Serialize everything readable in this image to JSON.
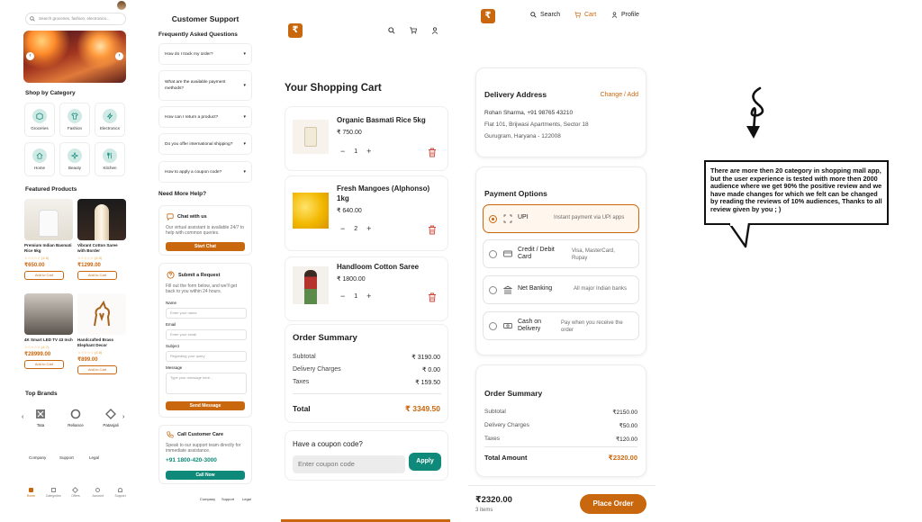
{
  "home": {
    "search_placeholder": "Search groceries, fashion, electronics...",
    "shop_by_category": "Shop by Category",
    "categories": [
      {
        "label": "Groceries",
        "icon": "grocery-icon"
      },
      {
        "label": "Fashion",
        "icon": "shirt-icon"
      },
      {
        "label": "Electronics",
        "icon": "bolt-icon"
      },
      {
        "label": "Home",
        "icon": "home-icon"
      },
      {
        "label": "Beauty",
        "icon": "beauty-icon"
      },
      {
        "label": "Kitchen",
        "icon": "kitchen-icon"
      }
    ],
    "featured_title": "Featured Products",
    "products": [
      {
        "name": "Premium Indian Basmati Rice 5kg",
        "rating": "☆☆☆☆☆ (4.6)",
        "price": "₹650.00",
        "cta": "Add to Cart"
      },
      {
        "name": "Vibrant Cotton Saree with Border",
        "rating": "☆☆☆☆☆ (4.5)",
        "price": "₹1299.00",
        "cta": "Add to Cart"
      },
      {
        "name": "4K Smart LED TV 43 Inch",
        "rating": "☆☆☆☆☆ (4.7)",
        "price": "₹28999.00",
        "cta": "Add to Cart"
      },
      {
        "name": "Handcrafted Brass Elephant Decor",
        "rating": "☆☆☆☆☆ (4.8)",
        "price": "₹899.00",
        "cta": "Add to Cart"
      }
    ],
    "top_brands_title": "Top Brands",
    "brands": [
      "Tata",
      "Reliance",
      "Patanjali"
    ],
    "footer_links": [
      "Company",
      "Support",
      "Legal"
    ],
    "bottom_nav": [
      "Home",
      "Categories",
      "Offers",
      "Account",
      "Support"
    ]
  },
  "support": {
    "title": "Customer Support",
    "faq_title": "Frequently Asked Questions",
    "faqs": [
      "How do I track my order?",
      "What are the available payment methods?",
      "How can I return a product?",
      "Do you offer international shipping?",
      "How to apply a coupon code?"
    ],
    "need_help": "Need More Help?",
    "chat_title": "Chat with us",
    "chat_desc": "Our virtual assistant is available 24/7 to help with common queries.",
    "chat_button": "Start Chat",
    "request_title": "Submit a Request",
    "request_desc": "Fill out the form below, and we'll get back to you within 24 hours.",
    "name_label": "Name",
    "name_placeholder": "Enter your name",
    "email_label": "Email",
    "email_placeholder": "Enter your email",
    "subject_label": "Subject",
    "subject_placeholder": "Regarding your query",
    "message_label": "Message",
    "message_placeholder": "Type your message here...",
    "send_button": "Send Message",
    "call_title": "Call Customer Care",
    "call_desc": "Speak to our support team directly for immediate assistance.",
    "phone": "+91 1800-420-3000",
    "call_button": "Call Now",
    "footer_links": [
      "Company",
      "Support",
      "Legal"
    ]
  },
  "cart": {
    "logo": "₹",
    "title": "Your Shopping Cart",
    "items": [
      {
        "name": "Organic Basmati Rice 5kg",
        "price": "₹ 750.00",
        "qty": "1"
      },
      {
        "name": "Fresh Mangoes (Alphonso) 1kg",
        "price": "₹ 640.00",
        "qty": "2"
      },
      {
        "name": "Handloom Cotton Saree",
        "price": "₹ 1800.00",
        "qty": "1"
      }
    ],
    "summary_title": "Order Summary",
    "subtotal_label": "Subtotal",
    "subtotal": "₹ 3190.00",
    "delivery_label": "Delivery Charges",
    "delivery": "₹ 0.00",
    "taxes_label": "Taxes",
    "taxes": "₹ 159.50",
    "total_label": "Total",
    "total": "₹ 3349.50",
    "coupon_title": "Have a coupon code?",
    "coupon_placeholder": "Enter coupon code",
    "apply_button": "Apply"
  },
  "checkout": {
    "logo": "₹",
    "nav": {
      "search": "Search",
      "cart": "Cart",
      "profile": "Profile"
    },
    "address_title": "Delivery Address",
    "change_link": "Change / Add",
    "address_name": "Rohan Sharma, +91 98765 43210",
    "address_line1": "Flat 101, Brijwasi Apartments, Sector 18",
    "address_line2": "Gurugram, Haryana - 122008",
    "payment_title": "Payment Options",
    "payment_options": [
      {
        "label": "UPI",
        "desc": "Instant payment via UPI apps",
        "icon": "scan-icon"
      },
      {
        "label": "Credit / Debit Card",
        "desc": "Visa, MasterCard, Rupay",
        "icon": "card-icon"
      },
      {
        "label": "Net Banking",
        "desc": "All major Indian banks",
        "icon": "bank-icon"
      },
      {
        "label": "Cash on Delivery",
        "desc": "Pay when you receive the order",
        "icon": "cash-icon"
      }
    ],
    "selected_payment": "UPI",
    "summary_title": "Order Summary",
    "subtotal_label": "Subtotal",
    "subtotal": "₹2150.00",
    "delivery_label": "Delivery Charges",
    "delivery": "₹50.00",
    "taxes_label": "Taxes",
    "taxes": "₹120.00",
    "total_label": "Total Amount",
    "total": "₹2320.00",
    "bottom_total": "₹2320.00",
    "bottom_items": "3 items",
    "place_order": "Place Order"
  },
  "annotation": {
    "text": "There are more then 20 category in shopping mall app, but the user experience is tested with more then 2000 audience where we get 90% the positive review and we have made changes for which we felt can be changed by reading the reviews of 10% audiences, Thanks to all review given by you ; )"
  },
  "colors": {
    "accent": "#c9670e",
    "teal": "#0f8a7a",
    "icon_bg": "#cfe9e4"
  }
}
